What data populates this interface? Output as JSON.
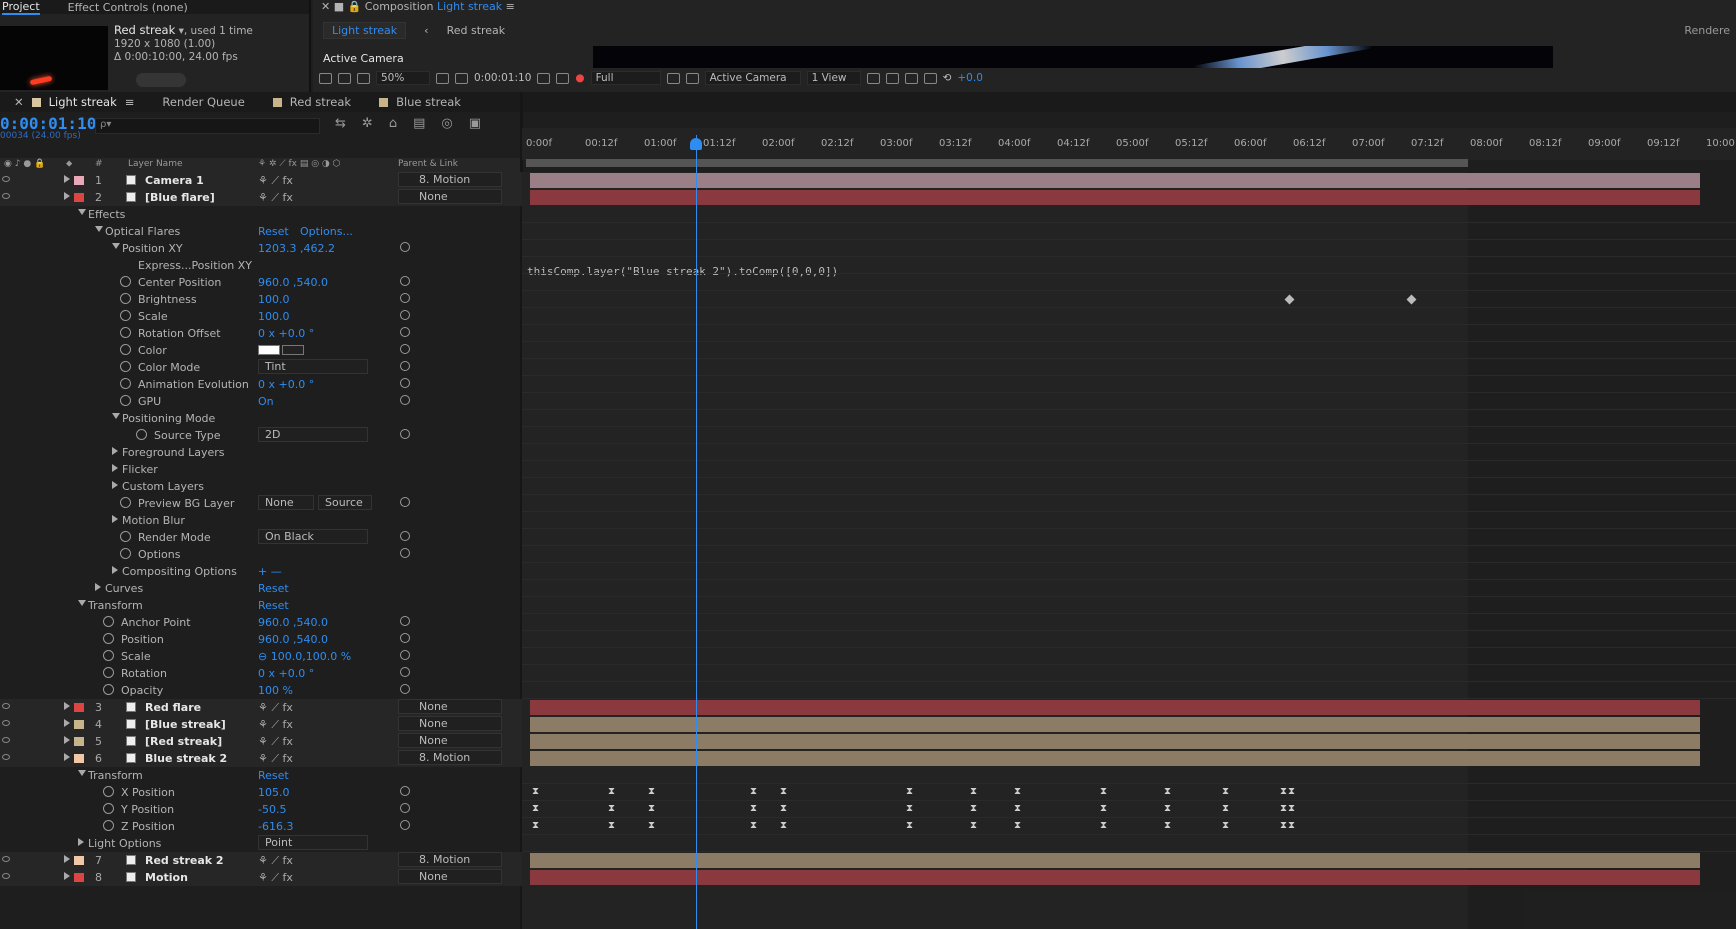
{
  "project_panel": {
    "tabs": [
      "Project",
      "Effect Controls (none)"
    ],
    "item_name": "Red streak",
    "used": ", used 1 time",
    "resolution": "1920 x 1080 (1.00)",
    "duration": "Δ 0:00:10:00, 24.00 fps"
  },
  "comp_panel": {
    "label": "Composition",
    "name": "Light streak",
    "tabs": [
      "Light streak",
      "Red streak"
    ],
    "active_camera_label": "Active Camera",
    "rendere": "Rendere",
    "toolbar": {
      "zoom": "50%",
      "time": "0:00:01:10",
      "resolution": "Full",
      "camera": "Active Camera",
      "views": "1 View",
      "exposure": "+0.0"
    }
  },
  "timeline_tabs": [
    {
      "label": "Light streak",
      "color": "#d8c6a0"
    },
    {
      "label": "Render Queue",
      "color": ""
    },
    {
      "label": "Red streak",
      "color": "#c8b48a"
    },
    {
      "label": "Blue streak",
      "color": "#c8b48a"
    }
  ],
  "timecode": "0:00:01:10",
  "fps": "00034 (24.00 fps)",
  "search_placeholder": "ρ▾",
  "columns": {
    "num": "#",
    "layer_name": "Layer Name",
    "parent": "Parent & Link"
  },
  "ruler": [
    "0:00f",
    "00:12f",
    "01:00f",
    "01:12f",
    "02:00f",
    "02:12f",
    "03:00f",
    "03:12f",
    "04:00f",
    "04:12f",
    "05:00f",
    "05:12f",
    "06:00f",
    "06:12f",
    "07:00f",
    "07:12f",
    "08:00f",
    "08:12f",
    "09:00f",
    "09:12f",
    "10:00"
  ],
  "expression_text": "thisComp.layer(\"Blue streak 2\").toComp([0,0,0])",
  "rows": [
    {
      "kind": "layer",
      "num": "1",
      "name": "Camera 1",
      "color": "#e8a8b8",
      "parent": "8. Motion"
    },
    {
      "kind": "layer",
      "num": "2",
      "name": "[Blue flare]",
      "color": "#d44",
      "parent": "None"
    },
    {
      "kind": "prop",
      "indent": 1,
      "name": "Effects"
    },
    {
      "kind": "prop",
      "indent": 2,
      "name": "Optical Flares",
      "value": "Reset",
      "extra": "Options..."
    },
    {
      "kind": "prop",
      "indent": 3,
      "name": "Position XY",
      "value": "1203.3 ,462.2",
      "red": true
    },
    {
      "kind": "prop",
      "indent": 4,
      "name": "Express...Position XY"
    },
    {
      "kind": "prop",
      "indent": 3,
      "name": "Center Position",
      "value": "960.0 ,540.0"
    },
    {
      "kind": "prop",
      "indent": 3,
      "name": "Brightness",
      "value": "100.0"
    },
    {
      "kind": "prop",
      "indent": 3,
      "name": "Scale",
      "value": "100.0"
    },
    {
      "kind": "prop",
      "indent": 3,
      "name": "Rotation Offset",
      "value": "0 x +0.0 °"
    },
    {
      "kind": "prop",
      "indent": 3,
      "name": "Color",
      "value": ""
    },
    {
      "kind": "prop",
      "indent": 3,
      "name": "Color Mode",
      "value": "Tint",
      "dd": true
    },
    {
      "kind": "prop",
      "indent": 3,
      "name": "Animation Evolution",
      "value": "0 x +0.0 °"
    },
    {
      "kind": "prop",
      "indent": 3,
      "name": "GPU",
      "value": "On"
    },
    {
      "kind": "prop",
      "indent": 3,
      "name": "Positioning Mode"
    },
    {
      "kind": "prop",
      "indent": 4,
      "name": "Source Type",
      "value": "2D",
      "dd": true
    },
    {
      "kind": "prop",
      "indent": 3,
      "name": "Foreground Layers"
    },
    {
      "kind": "prop",
      "indent": 3,
      "name": "Flicker"
    },
    {
      "kind": "prop",
      "indent": 3,
      "name": "Custom Layers"
    },
    {
      "kind": "prop",
      "indent": 3,
      "name": "Preview BG Layer",
      "value": "None",
      "value2": "Source"
    },
    {
      "kind": "prop",
      "indent": 3,
      "name": "Motion Blur"
    },
    {
      "kind": "prop",
      "indent": 3,
      "name": "Render Mode",
      "value": "On Black",
      "dd": true
    },
    {
      "kind": "prop",
      "indent": 3,
      "name": "Options"
    },
    {
      "kind": "prop",
      "indent": 3,
      "name": "Compositing Options",
      "value": "+ —"
    },
    {
      "kind": "prop",
      "indent": 2,
      "name": "Curves",
      "value": "Reset"
    },
    {
      "kind": "prop",
      "indent": 1,
      "name": "Transform",
      "value": "Reset"
    },
    {
      "kind": "prop",
      "indent": 2,
      "name": "Anchor Point",
      "value": "960.0 ,540.0"
    },
    {
      "kind": "prop",
      "indent": 2,
      "name": "Position",
      "value": "960.0 ,540.0"
    },
    {
      "kind": "prop",
      "indent": 2,
      "name": "Scale",
      "value": "⊖ 100.0,100.0 %"
    },
    {
      "kind": "prop",
      "indent": 2,
      "name": "Rotation",
      "value": "0 x +0.0 °"
    },
    {
      "kind": "prop",
      "indent": 2,
      "name": "Opacity",
      "value": "100 %"
    },
    {
      "kind": "layer",
      "num": "3",
      "name": "Red flare",
      "color": "#d44",
      "parent": "None"
    },
    {
      "kind": "layer",
      "num": "4",
      "name": "[Blue streak]",
      "color": "#c8b48a",
      "parent": "None"
    },
    {
      "kind": "layer",
      "num": "5",
      "name": "[Red streak]",
      "color": "#c8b48a",
      "parent": "None"
    },
    {
      "kind": "layer",
      "num": "6",
      "name": "Blue streak 2",
      "color": "#f0c8a8",
      "parent": "8. Motion"
    },
    {
      "kind": "prop",
      "indent": 1,
      "name": "Transform",
      "value": "Reset"
    },
    {
      "kind": "prop",
      "indent": 2,
      "name": "X Position",
      "value": "105.0"
    },
    {
      "kind": "prop",
      "indent": 2,
      "name": "Y Position",
      "value": "-50.5"
    },
    {
      "kind": "prop",
      "indent": 2,
      "name": "Z Position",
      "value": "-616.3"
    },
    {
      "kind": "prop",
      "indent": 1,
      "name": "Light Options",
      "value": "Point",
      "dd": true
    },
    {
      "kind": "layer",
      "num": "7",
      "name": "Red streak 2",
      "color": "#f0c8a8",
      "parent": "8. Motion"
    },
    {
      "kind": "layer",
      "num": "8",
      "name": "Motion",
      "color": "#d44",
      "parent": "None"
    }
  ]
}
